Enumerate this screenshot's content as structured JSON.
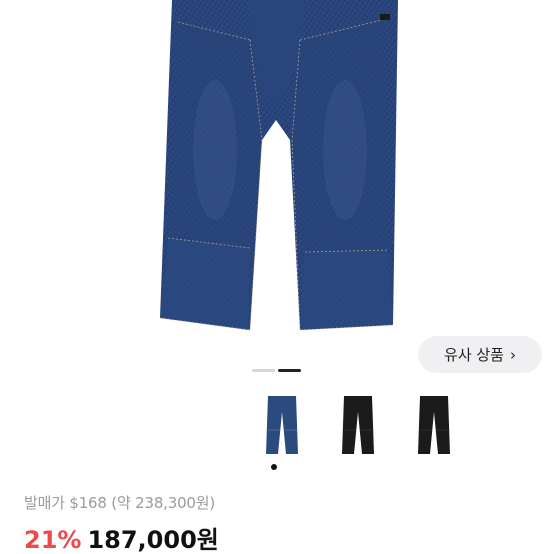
{
  "similar_button": {
    "label": "유사 상품",
    "chevron": "›"
  },
  "indicator": {
    "inactive_color": "#d8d8d8",
    "active_color": "#222222"
  },
  "thumbnails": [
    {
      "name": "denim-blue-variant",
      "color": "#2b4a7e"
    },
    {
      "name": "black-variant-1",
      "color": "#1b1b1b"
    },
    {
      "name": "black-variant-2",
      "color": "#1b1b1b"
    }
  ],
  "release_price_text": "발매가 $168 (약 238,300원)",
  "discount_text": "21%",
  "price_text": "187,000원",
  "colors": {
    "discount": "#ef4a4a",
    "denim": "#2e4c83"
  }
}
